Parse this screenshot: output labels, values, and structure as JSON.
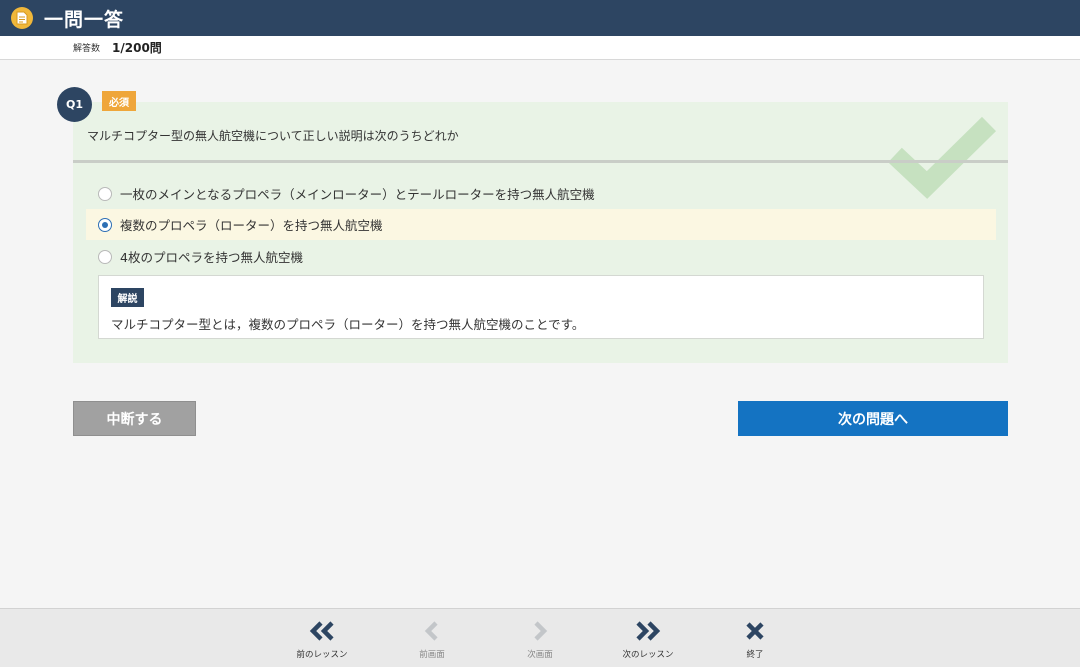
{
  "header": {
    "title": "一問一答"
  },
  "counter": {
    "label": "解答数",
    "value": "1/200問"
  },
  "question": {
    "badge": "Q1",
    "tag": "必須",
    "text": "マルチコプター型の無人航空機について正しい説明は次のうちどれか",
    "result": "correct",
    "choices": [
      {
        "label": "一枚のメインとなるプロペラ（メインローター）とテールローターを持つ無人航空機",
        "selected": false
      },
      {
        "label": "複数のプロペラ（ローター）を持つ無人航空機",
        "selected": true
      },
      {
        "label": "4枚のプロペラを持つ無人航空機",
        "selected": false
      }
    ],
    "explanation": {
      "tag": "解説",
      "text": "マルチコプター型とは，複数のプロペラ（ローター）を持つ無人航空機のことです。"
    }
  },
  "buttons": {
    "pause": "中断する",
    "next": "次の問題へ"
  },
  "bottom_nav": {
    "prev_lesson": "前のレッスン",
    "prev_screen": "前画面",
    "next_screen": "次画面",
    "next_lesson": "次のレッスン",
    "exit": "終了"
  },
  "colors": {
    "header_bg": "#2d4562",
    "accent_blue": "#1473c2",
    "required_tag": "#efa63a",
    "question_bg": "#e9f3e6",
    "selected_bg": "#fbf7e2"
  }
}
